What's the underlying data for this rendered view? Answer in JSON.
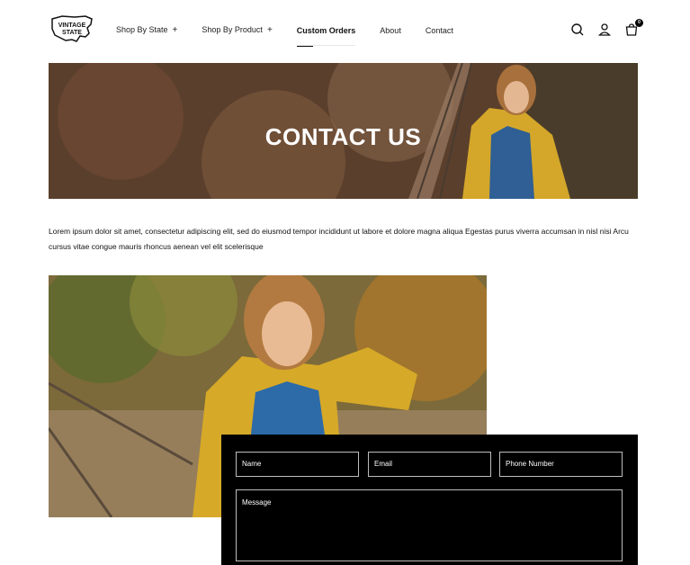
{
  "brand": {
    "logo_line1": "VINTAGE",
    "logo_line2": "STATE"
  },
  "nav": {
    "items": [
      {
        "label": "Shop By State",
        "has_plus": "+"
      },
      {
        "label": "Shop By Product",
        "has_plus": "+"
      },
      {
        "label": "Custom Orders"
      },
      {
        "label": "About"
      },
      {
        "label": "Contact"
      }
    ]
  },
  "header_icons": {
    "search": "search-icon",
    "account": "user-icon",
    "cart": "cart-icon",
    "cart_count": "0"
  },
  "hero": {
    "title": "CONTACT US"
  },
  "intro": {
    "text": "Lorem ipsum dolor sit amet, consectetur adipiscing elit, sed do eiusmod tempor incididunt ut labore et dolore magna aliqua Egestas purus viverra accumsan in nisl nisi Arcu cursus vitae congue mauris rhoncus aenean vel elit scelerisque"
  },
  "form": {
    "name_placeholder": "Name",
    "email_placeholder": "Email",
    "phone_placeholder": "Phone Number",
    "message_placeholder": "Message"
  },
  "colors": {
    "form_bg": "#000000",
    "field_border": "#bdbdbd",
    "text": "#111111"
  }
}
